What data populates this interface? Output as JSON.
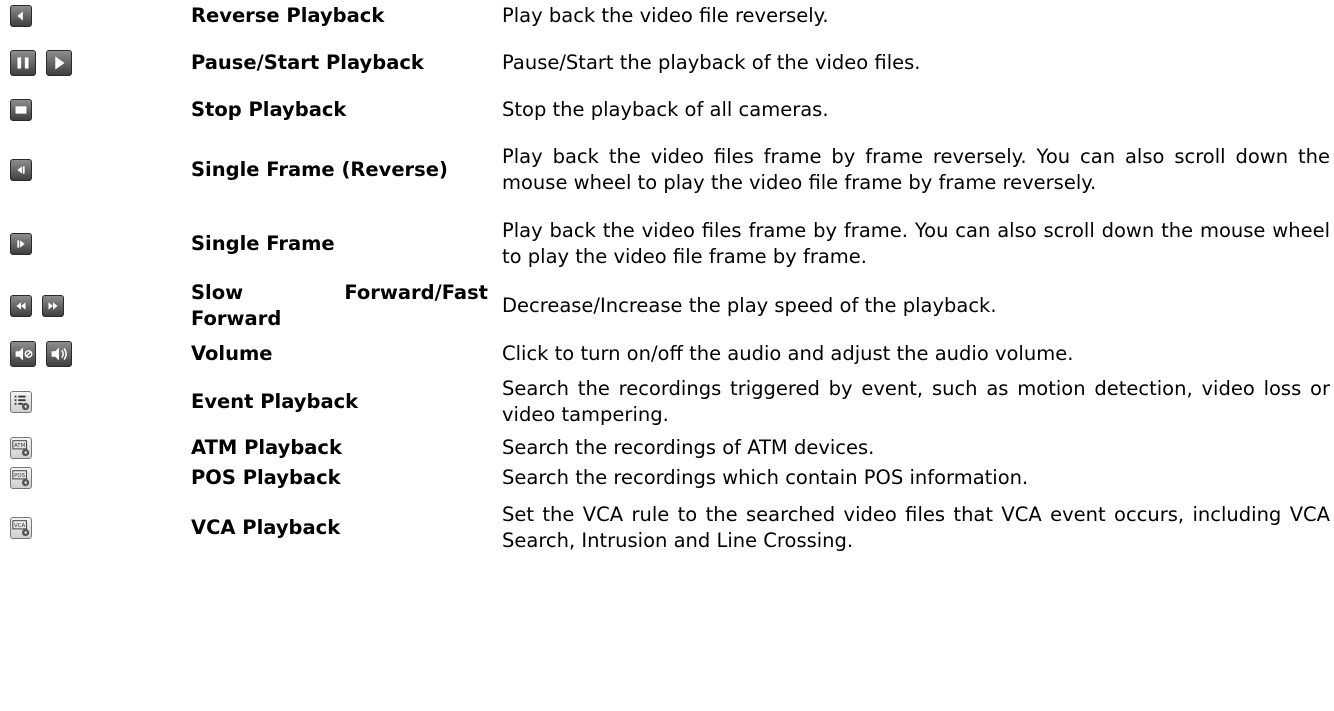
{
  "rows": [
    {
      "icons": [
        "reverse-playback-icon"
      ],
      "name": "Reverse Playback",
      "description": "Play back the video file reversely."
    },
    {
      "icons": [
        "pause-icon",
        "start-icon"
      ],
      "name": "Pause/Start Playback",
      "description": "Pause/Start the playback of the video files."
    },
    {
      "icons": [
        "stop-icon"
      ],
      "name": "Stop Playback",
      "description": "Stop the playback of all cameras."
    },
    {
      "icons": [
        "single-frame-reverse-icon"
      ],
      "name": "Single Frame (Reverse)",
      "description": "Play back the video files frame by frame reversely. You can also scroll down the mouse wheel to play the video file frame by frame reversely."
    },
    {
      "icons": [
        "single-frame-icon"
      ],
      "name": "Single Frame",
      "description": "Play back the video files frame by frame. You can also scroll down the mouse wheel to play the video file frame by frame."
    },
    {
      "icons": [
        "slow-forward-icon",
        "fast-forward-icon"
      ],
      "name": "Slow Forward/Fast Forward",
      "description": "Decrease/Increase the play speed of the playback."
    },
    {
      "icons": [
        "volume-off-icon",
        "volume-on-icon"
      ],
      "name": "Volume",
      "description": "Click to turn on/off the audio and adjust the audio volume."
    },
    {
      "icons": [
        "event-playback-icon"
      ],
      "name": "Event Playback",
      "description": "Search the recordings triggered by event, such as motion detection, video loss or video tampering."
    },
    {
      "icons": [
        "atm-playback-icon"
      ],
      "name": "ATM Playback",
      "description": "Search the recordings of ATM devices."
    },
    {
      "icons": [
        "pos-playback-icon"
      ],
      "name": "POS Playback",
      "description": "Search the recordings which contain POS information."
    },
    {
      "icons": [
        "vca-playback-icon"
      ],
      "name": "VCA Playback",
      "description": "Set the VCA rule to the searched video files that VCA event occurs, including VCA Search, Intrusion and Line Crossing."
    }
  ],
  "icon_labels": {
    "atm": "ATM",
    "pos": "POS",
    "vca": "VCA"
  }
}
